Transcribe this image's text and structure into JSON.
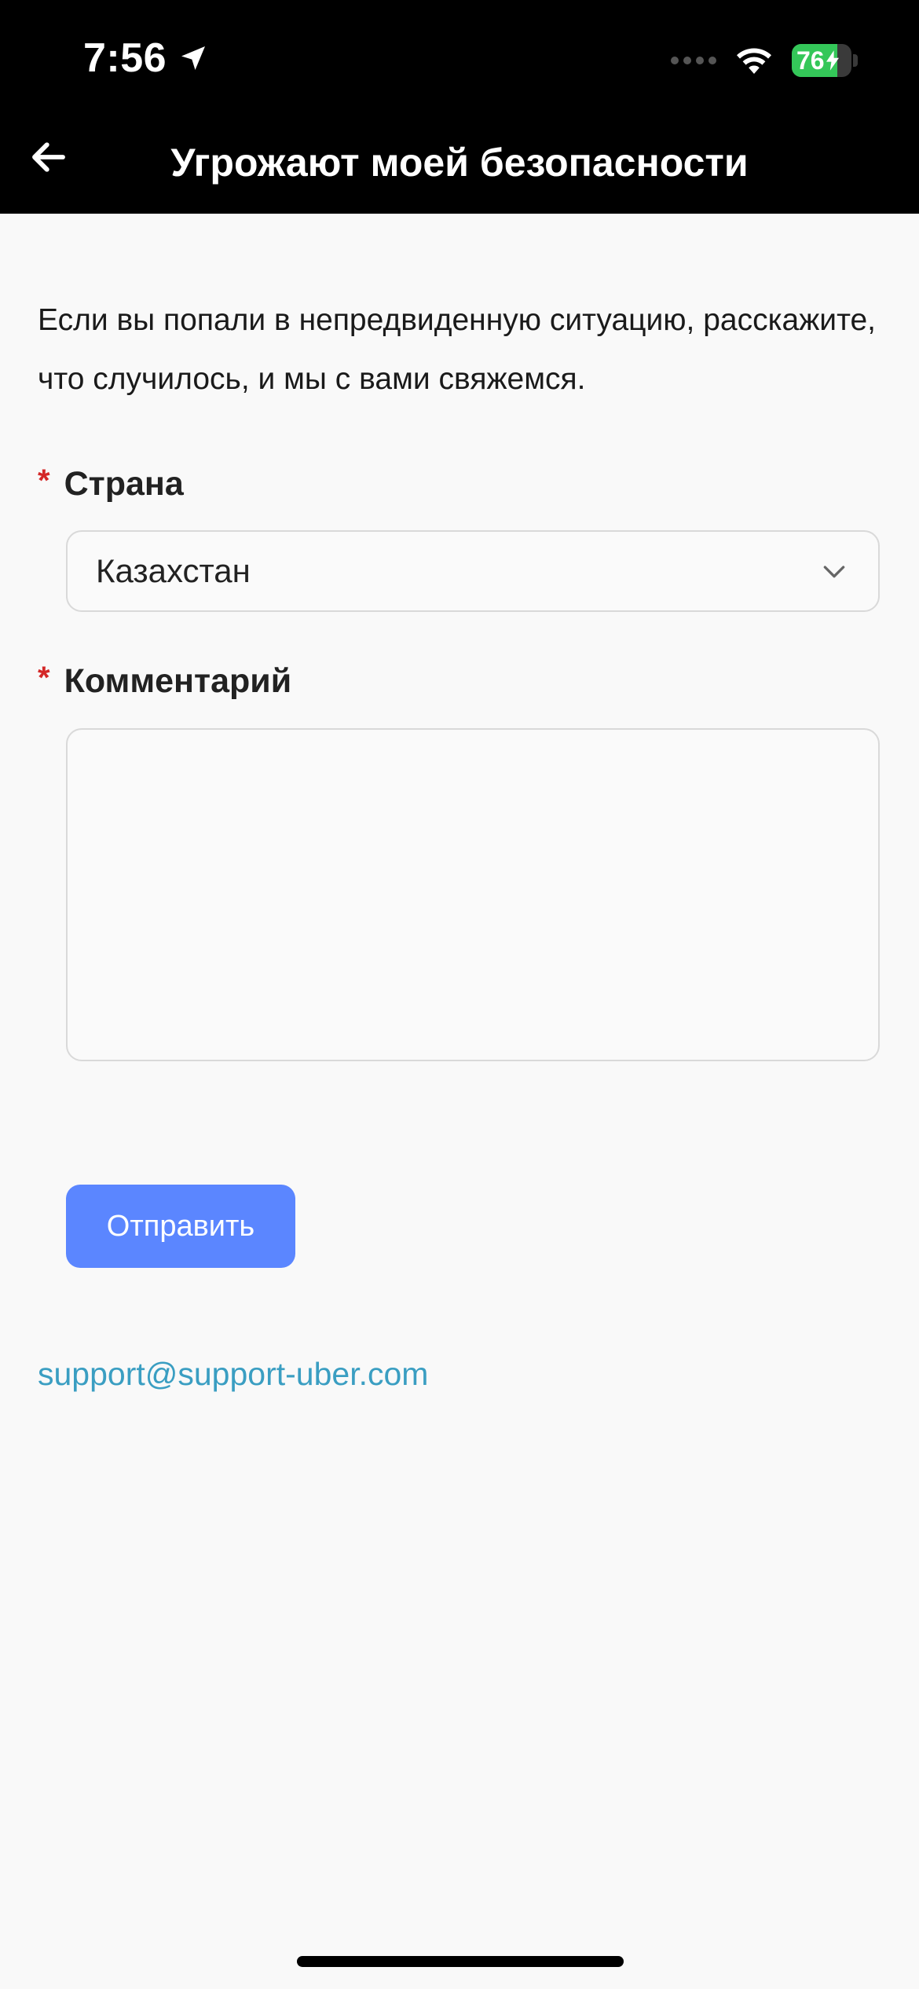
{
  "status_bar": {
    "time": "7:56",
    "battery": "76",
    "battery_level": 0.76
  },
  "nav": {
    "title": "Угрожают моей безопасности"
  },
  "intro_text": "Если вы попали в непредвиденную ситуацию, расскажите, что случилось, и мы с вами свяжемся.",
  "form": {
    "required_marker": "*",
    "country": {
      "label": "Страна",
      "value": "Казахстан"
    },
    "comment": {
      "label": "Комментарий",
      "value": ""
    },
    "submit_label": "Отправить"
  },
  "support_email": "support@support-uber.com",
  "colors": {
    "accent": "#5b86ff",
    "link": "#3a9ec2",
    "required": "#d42828",
    "battery": "#34c759"
  }
}
